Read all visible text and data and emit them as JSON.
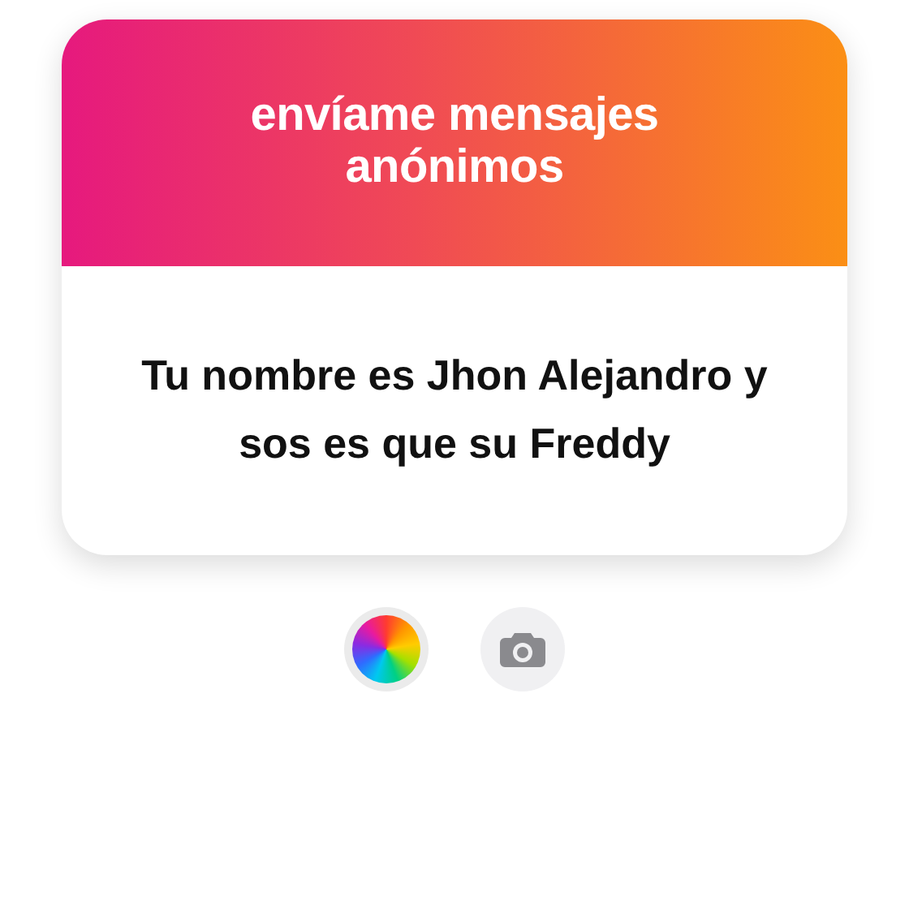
{
  "card": {
    "title": "envíame mensajes anónimos",
    "message": "Tu nombre es Jhon Alejandro y sos es que su Freddy"
  },
  "buttons": [
    {
      "kind": "color"
    },
    {
      "kind": "camera"
    }
  ]
}
